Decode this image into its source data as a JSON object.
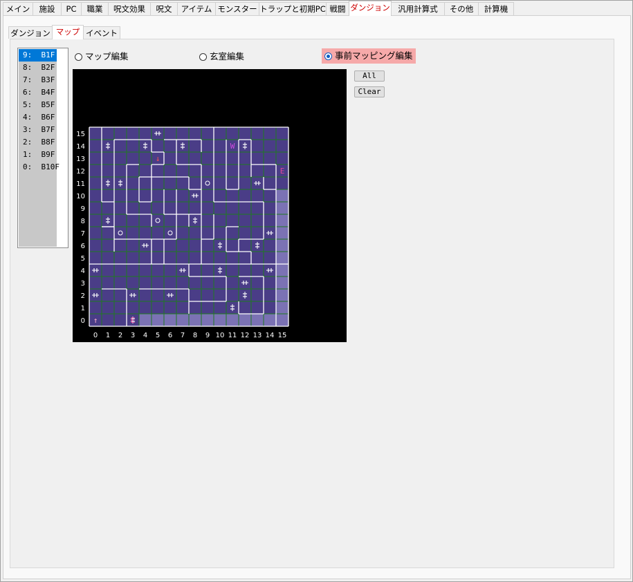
{
  "top_tabs": [
    {
      "label": "メイン",
      "active": false
    },
    {
      "label": "施設",
      "active": false
    },
    {
      "label": "PC",
      "active": false
    },
    {
      "label": "職業",
      "active": false
    },
    {
      "label": "呪文効果",
      "active": false
    },
    {
      "label": "呪文",
      "active": false
    },
    {
      "label": "アイテム",
      "active": false
    },
    {
      "label": "モンスター",
      "active": false
    },
    {
      "label": "トラップと初期PC",
      "active": false
    },
    {
      "label": "戦闘",
      "active": false
    },
    {
      "label": "ダンジョン",
      "active": true
    },
    {
      "label": "汎用計算式",
      "active": false
    },
    {
      "label": "その他",
      "active": false
    },
    {
      "label": "計算機",
      "active": false
    }
  ],
  "sub_tabs": [
    {
      "label": "ダンジョン",
      "active": false
    },
    {
      "label": "マップ",
      "active": true
    },
    {
      "label": "イベント",
      "active": false
    }
  ],
  "floors": [
    {
      "label": "9:  B1F",
      "selected": true
    },
    {
      "label": "8:  B2F",
      "selected": false
    },
    {
      "label": "7:  B3F",
      "selected": false
    },
    {
      "label": "6:  B4F",
      "selected": false
    },
    {
      "label": "5:  B5F",
      "selected": false
    },
    {
      "label": "4:  B6F",
      "selected": false
    },
    {
      "label": "3:  B7F",
      "selected": false
    },
    {
      "label": "2:  B8F",
      "selected": false
    },
    {
      "label": "1:  B9F",
      "selected": false
    },
    {
      "label": "0:  B10F",
      "selected": false
    }
  ],
  "modes": [
    {
      "label": "マップ編集",
      "checked": false
    },
    {
      "label": "玄室編集",
      "checked": false
    },
    {
      "label": "事前マッピング編集",
      "checked": true
    }
  ],
  "buttons": {
    "all": "All",
    "clear": "Clear"
  },
  "map": {
    "x_labels": [
      "0",
      "1",
      "2",
      "3",
      "4",
      "5",
      "6",
      "7",
      "8",
      "9",
      "10",
      "11",
      "12",
      "13",
      "14",
      "15"
    ],
    "y_labels": [
      "15",
      "14",
      "13",
      "12",
      "11",
      "10",
      "9",
      "8",
      "7",
      "6",
      "5",
      "4",
      "3",
      "2",
      "1",
      "0"
    ],
    "markers": [
      {
        "text": "W",
        "col": 11,
        "row": 14,
        "color": "#d04adf"
      },
      {
        "text": "E",
        "col": 15,
        "row": 12,
        "color": "#e0479a"
      },
      {
        "text": "E",
        "col": 3,
        "row": 0,
        "color": "#e0479a"
      },
      {
        "text": "↓",
        "col": 5,
        "row": 13,
        "color": "#ff5050"
      },
      {
        "text": "↑",
        "col": 0,
        "row": 0,
        "color": "#ffb0d0"
      }
    ],
    "colors": {
      "unmapped": "#4a3d87",
      "mapped": "#7b72b4",
      "grid": "#1f7a1f",
      "wall": "#ffffff",
      "background": "#000000"
    }
  }
}
